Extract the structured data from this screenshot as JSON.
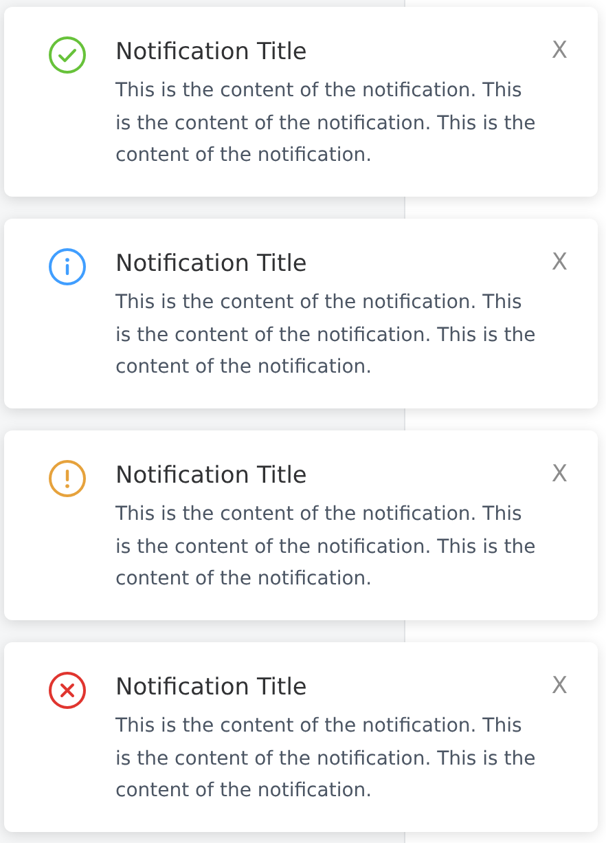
{
  "notifications": [
    {
      "kind": "success",
      "title": "Notification Title",
      "message": "This is the content of the notification. This is the content of the notification. This is the content of the notification.",
      "close": "X"
    },
    {
      "kind": "info",
      "title": "Notification Title",
      "message": "This is the content of the notification. This is the content of the notification. This is the content of the notification.",
      "close": "X"
    },
    {
      "kind": "warning",
      "title": "Notification Title",
      "message": "This is the content of the notification. This is the content of the notification. This is the content of the notification.",
      "close": "X"
    },
    {
      "kind": "error",
      "title": "Notification Title",
      "message": "This is the content of the notification. This is the content of the notification. This is the content of the notification.",
      "close": "X"
    }
  ]
}
